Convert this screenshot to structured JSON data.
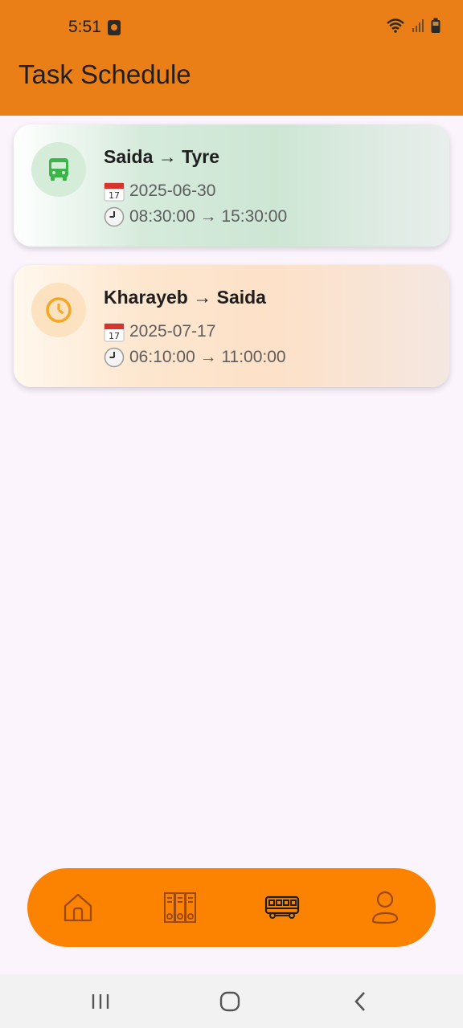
{
  "status_bar": {
    "time": "5:51"
  },
  "header": {
    "title": "Task Schedule"
  },
  "tasks": [
    {
      "route": "Saida → Tyre",
      "date": "2025-06-30",
      "time_range": "08:30:00 → 15:30:00",
      "icon": "bus-icon",
      "status_color": "#3bb54a"
    },
    {
      "route": "Kharayeb → Saida",
      "date": "2025-07-17",
      "time_range": "06:10:00 → 11:00:00",
      "icon": "clock-icon",
      "status_color": "#f5a623"
    }
  ],
  "bottom_nav": {
    "items": [
      "home-icon",
      "lockers-icon",
      "bus-icon",
      "profile-icon"
    ],
    "active": "bus-icon",
    "background": "#fc8201"
  },
  "colors": {
    "appbar": "#eb7f17",
    "background": "#fcf4fc"
  }
}
